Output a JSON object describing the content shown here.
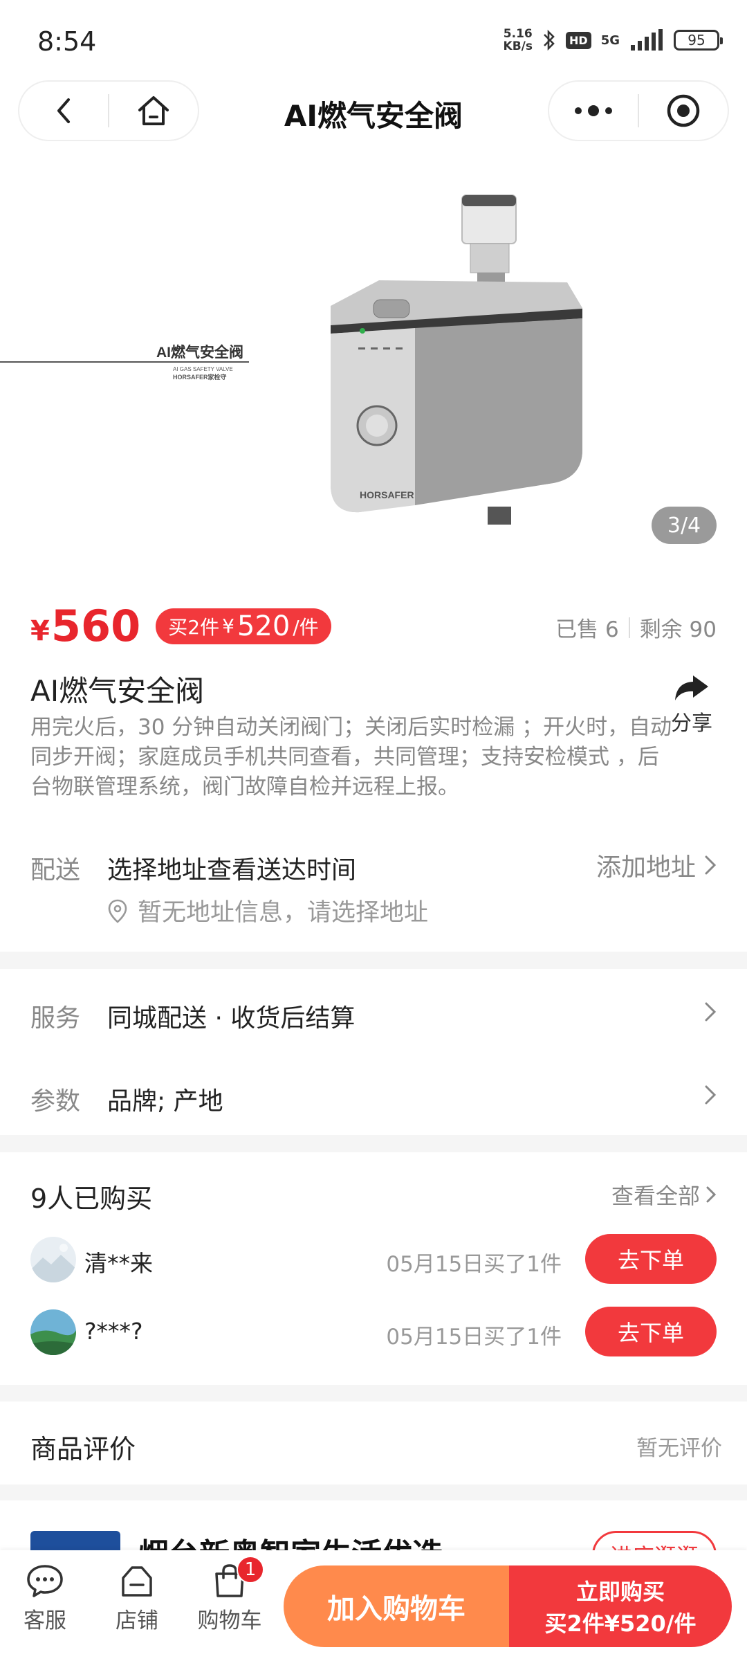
{
  "status_bar": {
    "time": "8:54",
    "net_speed_top": "5.16",
    "net_speed_bottom": "KB/s",
    "hd_label": "HD",
    "network": "5G",
    "battery": "95"
  },
  "nav": {
    "title": "AI燃气安全阀",
    "back_icon": "chevron-left-icon",
    "home_icon": "home-icon",
    "more_icon": "more-dots-icon",
    "target_icon": "target-icon"
  },
  "gallery": {
    "counter": "3/4",
    "banner_title": "AI燃气安全阀",
    "banner_sub": "AI GAS SAFETY VALVE",
    "banner_brand": "HORSAFER家栓守",
    "device_brand": "HORSAFER"
  },
  "price": {
    "symbol": "¥",
    "value": "560",
    "promo_prefix": "买2件",
    "promo_symbol": "¥",
    "promo_value": "520",
    "promo_suffix": "/件",
    "sold": "已售 6",
    "remaining": "剩余 90"
  },
  "product": {
    "name": "AI燃气安全阀",
    "share_label": "分享",
    "description": "用完火后，30 分钟自动关闭阀门；关闭后实时检漏 ；开火时，自动同步开阀；家庭成员手机共同查看，共同管理；支持安检模式 ，后台物联管理系统，阀门故障自检并远程上报。"
  },
  "delivery": {
    "label": "配送",
    "main": "选择地址查看送达时间",
    "add": "添加地址",
    "sub": "暂无地址信息，请选择地址"
  },
  "services": [
    {
      "label": "服务",
      "value": "同城配送 · 收货后结算"
    },
    {
      "label": "参数",
      "value": "品牌; 产地"
    }
  ],
  "buyers": {
    "title": "9人已购买",
    "view_all": "查看全部",
    "rows": [
      {
        "name": "清**来",
        "time": "05月15日买了1件",
        "button": "去下单"
      },
      {
        "name": "?***?",
        "time": "05月15日买了1件",
        "button": "去下单"
      }
    ]
  },
  "reviews": {
    "title": "商品评价",
    "status": "暂无评价"
  },
  "shop": {
    "name": "烟台新奥智家生活优选",
    "button": "进店逛逛"
  },
  "bottom_bar": {
    "tabs": [
      {
        "label": "客服",
        "icon": "chat-icon"
      },
      {
        "label": "店铺",
        "icon": "shop-icon"
      },
      {
        "label": "购物车",
        "icon": "cart-icon",
        "badge": "1"
      }
    ],
    "add_to_cart": "加入购物车",
    "buy_now_line1": "立即购买",
    "buy_now_line2": "买2件¥520/件"
  },
  "colors": {
    "accent_red": "#f2393d",
    "price_red": "#e8262d",
    "cart_orange": "#ff8a4c"
  }
}
